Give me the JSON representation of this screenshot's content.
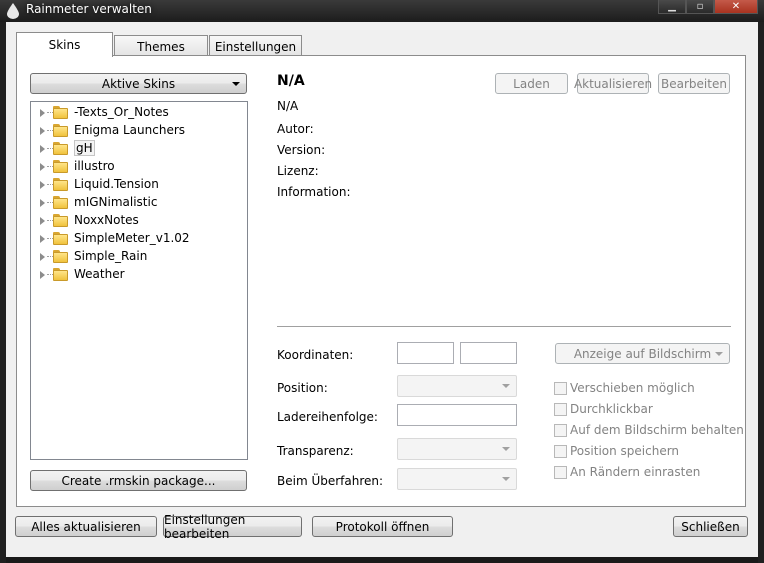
{
  "window": {
    "title": "Rainmeter verwalten",
    "minimize": "▁",
    "maximize": "▫",
    "close": "✕"
  },
  "tabs": [
    {
      "label": "Skins"
    },
    {
      "label": "Themes"
    },
    {
      "label": "Einstellungen"
    }
  ],
  "skins_panel": {
    "active_skins_dropdown": "Aktive Skins",
    "tree": [
      {
        "label": "-Texts_Or_Notes"
      },
      {
        "label": "Enigma Launchers"
      },
      {
        "label": "gH"
      },
      {
        "label": "illustro"
      },
      {
        "label": "Liquid.Tension"
      },
      {
        "label": "mIGNimalistic"
      },
      {
        "label": "NoxxNotes"
      },
      {
        "label": "SimpleMeter_v1.02"
      },
      {
        "label": "Simple_Rain"
      },
      {
        "label": "Weather"
      }
    ],
    "create_package_button": "Create .rmskin package..."
  },
  "details": {
    "title": "N/A",
    "subtitle": "N/A",
    "author_label": "Autor:",
    "version_label": "Version:",
    "license_label": "Lizenz:",
    "information_label": "Information:",
    "load_button": "Laden",
    "refresh_button": "Aktualisieren",
    "edit_button": "Bearbeiten"
  },
  "settings": {
    "coordinates_label": "Koordinaten:",
    "coordinate_x": "",
    "coordinate_y": "",
    "display_dropdown": "Anzeige auf Bildschirm",
    "position_label": "Position:",
    "position_value": "",
    "load_order_label": "Ladereihenfolge:",
    "load_order_value": "",
    "transparency_label": "Transparenz:",
    "transparency_value": "",
    "on_hover_label": "Beim Überfahren:",
    "on_hover_value": "",
    "checkboxes": [
      {
        "label": "Verschieben möglich",
        "checked": false
      },
      {
        "label": "Durchklickbar",
        "checked": false
      },
      {
        "label": "Auf dem Bildschirm behalten",
        "checked": false
      },
      {
        "label": "Position speichern",
        "checked": false
      },
      {
        "label": "An Rändern einrasten",
        "checked": false
      }
    ]
  },
  "footer": {
    "refresh_all_button": "Alles aktualisieren",
    "edit_settings_button": "Einstellungen bearbeiten",
    "open_log_button": "Protokoll öffnen",
    "close_button": "Schließen"
  },
  "colors": {
    "titlebar": "#1c1c1c",
    "client": "#f0f0f0",
    "close_button": "#c45a4a",
    "folder": "#f0c23d"
  }
}
